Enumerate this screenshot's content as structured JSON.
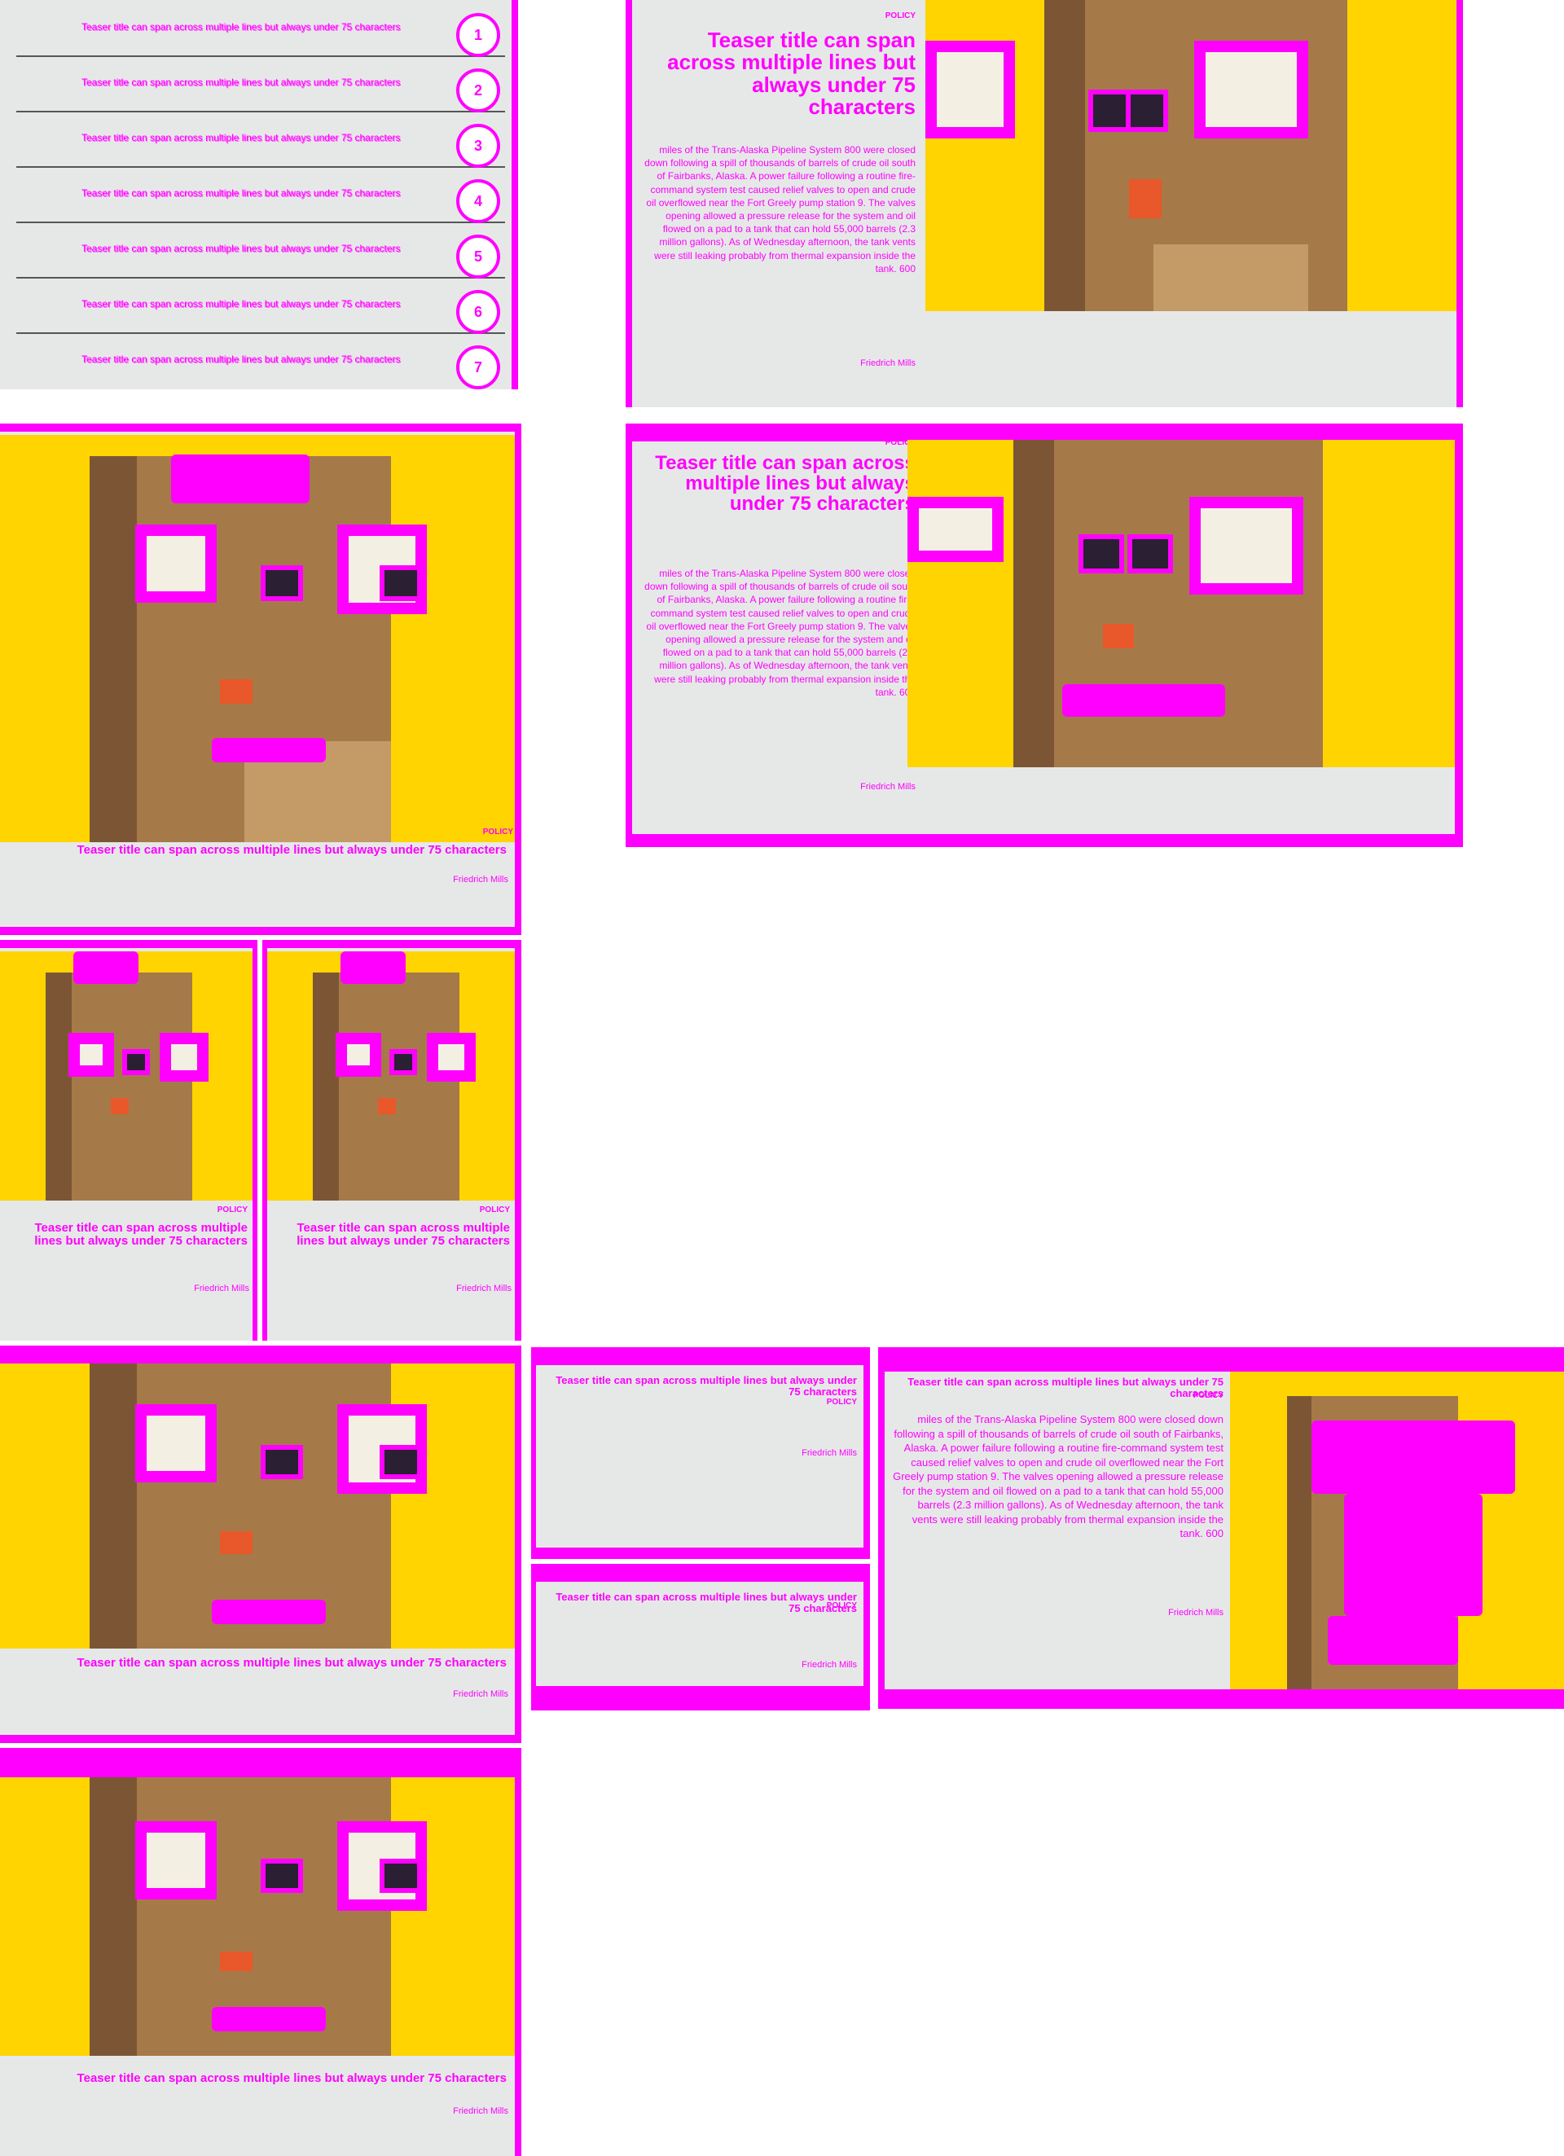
{
  "colors": {
    "accent": "#ff00ff",
    "panel": "#e6e8e8",
    "image_bg": "#ffd400"
  },
  "list": {
    "items": [
      {
        "text": "Teaser title can span across multiple lines but always under 75 characters",
        "num": "1"
      },
      {
        "text": "Teaser title can span across multiple lines but always under 75 characters",
        "num": "2"
      },
      {
        "text": "Teaser title can span across multiple lines but always under 75 characters",
        "num": "3"
      },
      {
        "text": "Teaser title can span across multiple lines but always under 75 characters",
        "num": "4"
      },
      {
        "text": "Teaser title can span across multiple lines but always under 75 characters",
        "num": "5"
      },
      {
        "text": "Teaser title can span across multiple lines but always under 75 characters",
        "num": "6"
      },
      {
        "text": "Teaser title can span across multiple lines but always under 75 characters",
        "num": "7"
      }
    ]
  },
  "card_common": {
    "kicker": "POLICY",
    "title": "Teaser title can span across multiple lines but always under 75 characters",
    "author": "Friedrich Mills",
    "body": "miles of the Trans-Alaska Pipeline System 800 were closed down following a spill of thousands of barrels of crude oil south of Fairbanks, Alaska. A power failure following a routine fire-command system test caused relief valves to open and crude oil overflowed near the Fort Greely pump station 9. The valves opening allowed a pressure release for the system and oil flowed on a pad to a tank that can hold 55,000 barrels (2.3 million gallons). As of Wednesday afternoon, the tank vents were still leaking probably from thermal expansion inside the tank. 600"
  }
}
